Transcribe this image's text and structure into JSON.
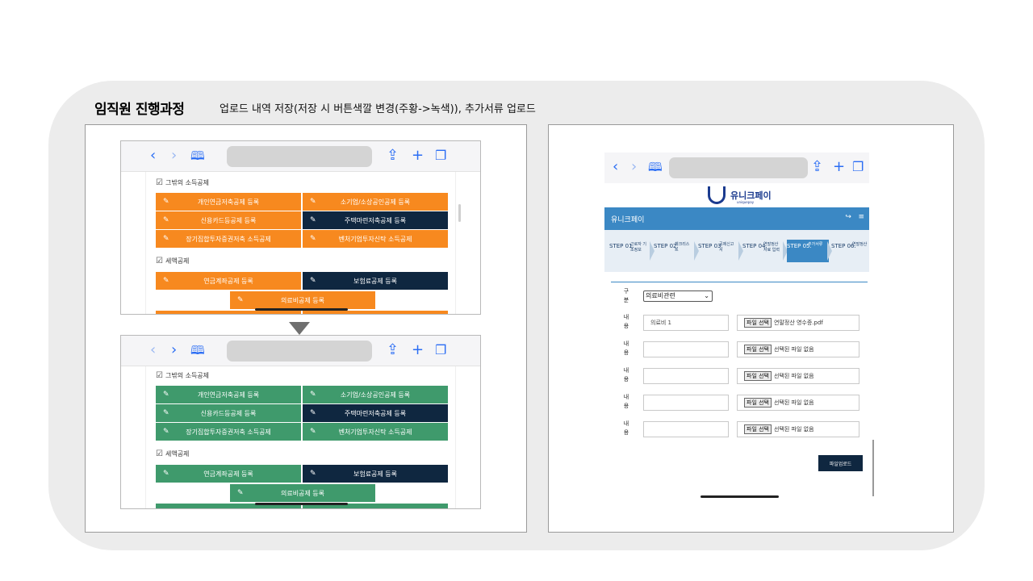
{
  "header": {
    "title": "임직원 진행과정",
    "description": "업로드 내역 저장(저장 시 버튼색깔 변경(주황->녹색)), 추가서류 업로드"
  },
  "browser": {
    "back_icon": "chevron-left-icon",
    "forward_icon": "chevron-right-icon",
    "bookmarks_icon": "book-icon",
    "share_icon": "share-icon",
    "new_tab_icon": "plus-icon",
    "tabs_icon": "tabs-icon"
  },
  "left_before": {
    "section1": "그밖의 소득공제",
    "section2": "세액공제",
    "buttons": [
      {
        "label": "개인연금저축공제 등록",
        "color": "#f7891f"
      },
      {
        "label": "소기업/소상공인공제 등록",
        "color": "#f7891f"
      },
      {
        "label": "신용카드등공제 등록",
        "color": "#f7891f"
      },
      {
        "label": "주택마련저축공제 등록",
        "color": "#0f2740"
      },
      {
        "label": "장기집합투자증권저축 소득공제",
        "color": "#f7891f"
      },
      {
        "label": "벤처기업투자신탁 소득공제",
        "color": "#f7891f"
      },
      {
        "label": "연금계좌공제 등록",
        "color": "#f7891f"
      },
      {
        "label": "보험료공제 등록",
        "color": "#0f2740"
      },
      {
        "label": "의료비공제 등록",
        "color": "#f7891f"
      }
    ]
  },
  "left_after": {
    "section1": "그밖의 소득공제",
    "section2": "세액공제",
    "buttons": [
      {
        "label": "개인연금저축공제 등록",
        "color": "#3f9a6c"
      },
      {
        "label": "소기업/소상공인공제 등록",
        "color": "#3f9a6c"
      },
      {
        "label": "신용카드등공제 등록",
        "color": "#3f9a6c"
      },
      {
        "label": "주택마련저축공제 등록",
        "color": "#0f2740"
      },
      {
        "label": "장기집합투자증권저축 소득공제",
        "color": "#3f9a6c"
      },
      {
        "label": "벤처기업투자신탁 소득공제",
        "color": "#3f9a6c"
      },
      {
        "label": "연금계좌공제 등록",
        "color": "#3f9a6c"
      },
      {
        "label": "보험료공제 등록",
        "color": "#0f2740"
      },
      {
        "label": "의료비공제 등록",
        "color": "#3f9a6c"
      }
    ]
  },
  "right": {
    "logo_text": "유니크페이",
    "logo_sub": "uniquepay",
    "app_title": "유니크페이",
    "steps": [
      {
        "num": "STEP 01.",
        "label": "근로자 기초정보"
      },
      {
        "num": "STEP 02.",
        "label": "체크리스트"
      },
      {
        "num": "STEP 03.",
        "label": "공제신고서"
      },
      {
        "num": "STEP 04.",
        "label": "연말정산 자료 입력"
      },
      {
        "num": "STEP 05.",
        "label": "추가서류"
      },
      {
        "num": "STEP 06.",
        "label": "연말정산"
      }
    ],
    "category_label": "구분",
    "category_value": "의료비관련",
    "content_label": "내용",
    "file_button": "파일 선택",
    "rows": [
      {
        "input": "의료비 1",
        "file": "연말정산 영수증.pdf"
      },
      {
        "input": "",
        "file": "선택된 파일 없음"
      },
      {
        "input": "",
        "file": "선택된 파일 없음"
      },
      {
        "input": "",
        "file": "선택된 파일 없음"
      },
      {
        "input": "",
        "file": "선택된 파일 없음"
      }
    ],
    "upload_button": "파일업로드"
  }
}
